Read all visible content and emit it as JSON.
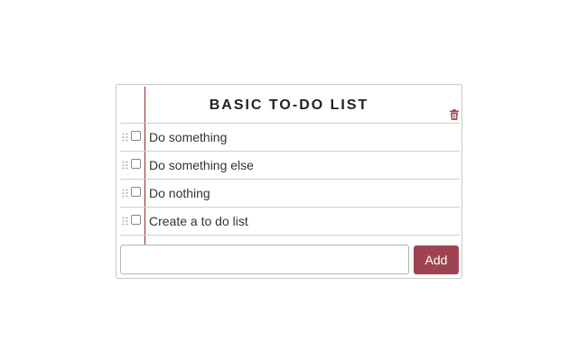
{
  "todo": {
    "title": "BASIC TO-DO LIST",
    "items": [
      {
        "label": "Do something",
        "checked": false
      },
      {
        "label": "Do something else",
        "checked": false
      },
      {
        "label": "Do nothing",
        "checked": false
      },
      {
        "label": "Create a to do list",
        "checked": false
      }
    ],
    "new_item_value": "",
    "add_label": "Add",
    "icons": {
      "clear": "trash-icon",
      "drag": "drag-handle-icon"
    },
    "colors": {
      "accent": "#9e4451",
      "margin_line": "#8b2e2e"
    }
  }
}
